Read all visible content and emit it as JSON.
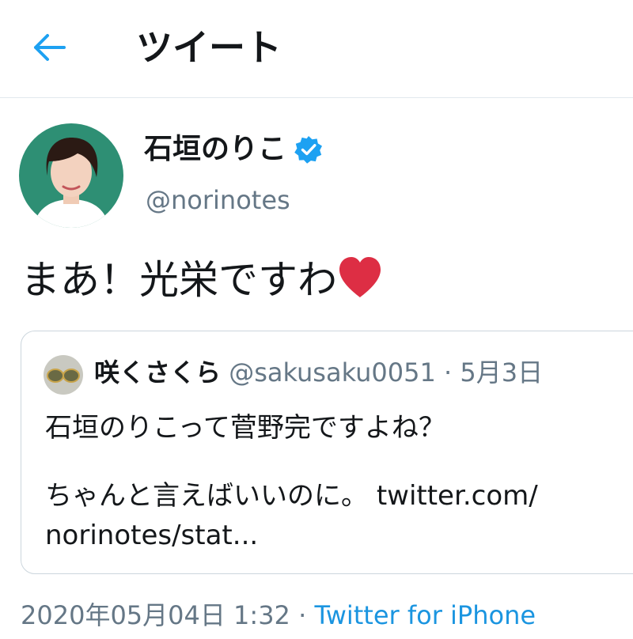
{
  "header": {
    "title": "ツイート",
    "back_icon": "arrow-left-icon",
    "accent_color": "#1da1f2"
  },
  "tweet": {
    "author": {
      "name": "石垣のりこ",
      "handle": "@norinotes",
      "verified": true,
      "verified_icon": "verified-badge-icon"
    },
    "text": "まあ！光栄ですわ",
    "emoji": "heart-icon",
    "quote": {
      "author_name": "咲くさくら",
      "meta": "@sakusaku0051 · 5月3日",
      "line1": "石垣のりこって菅野完ですよね？",
      "line2_text": "ちゃんと言えばいいのに。",
      "line2_link": "twitter.com/",
      "line3_link": "norinotes/stat..."
    },
    "timestamp": "2020年05月04日 1:32 · ",
    "source": "Twitter for iPhone"
  }
}
